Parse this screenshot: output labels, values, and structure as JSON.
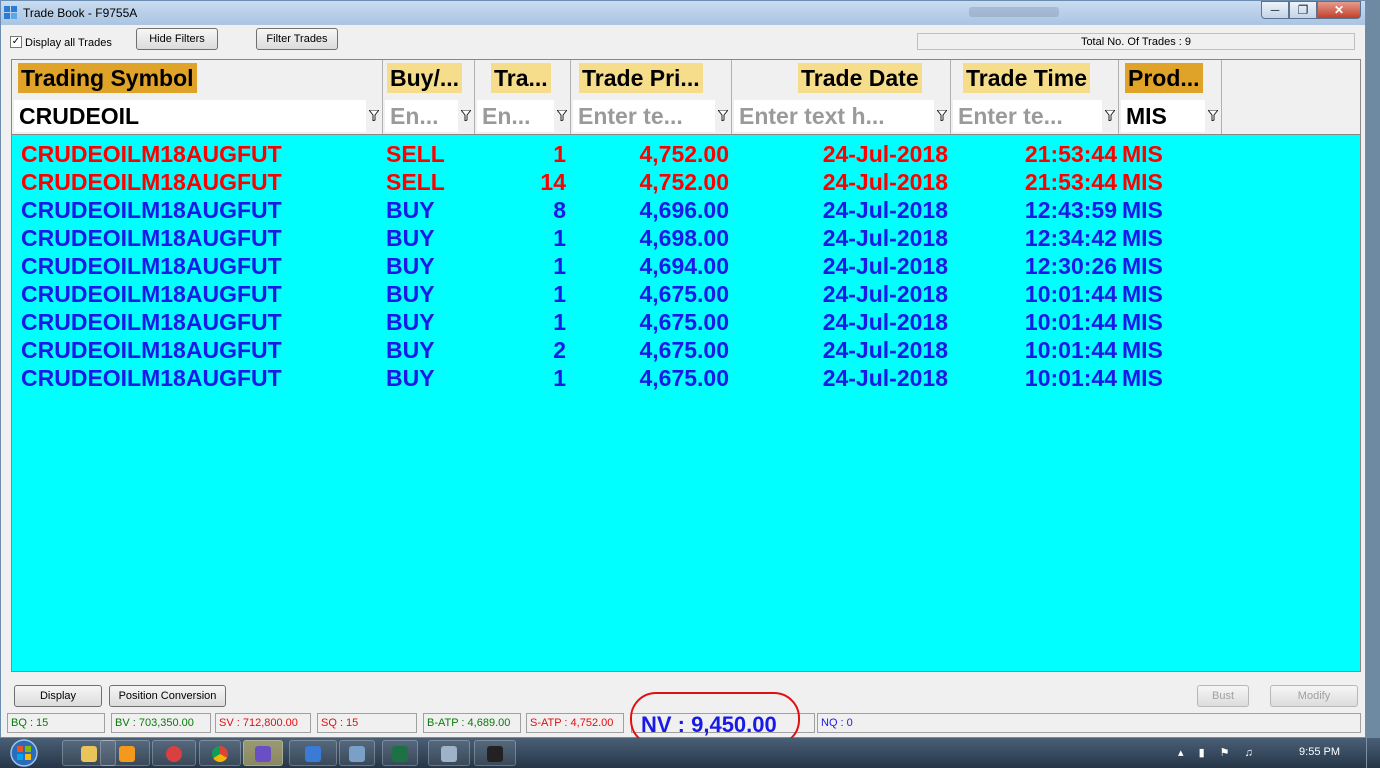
{
  "window": {
    "title": "Trade Book - F9755A"
  },
  "toolbar": {
    "display_all_trades_label": "Display all Trades",
    "display_all_trades_checked": true,
    "hide_filters_label": "Hide Filters",
    "filter_trades_label": "Filter Trades",
    "total_trades_text": "Total No. Of Trades : 9"
  },
  "grid": {
    "background_color": "#00ffff",
    "sell_color": "#ff0000",
    "buy_color": "#1a1ae6",
    "columns": [
      {
        "key": "symbol",
        "header": "Trading Symbol",
        "filter": "CRUDEOIL",
        "filter_is_placeholder": false
      },
      {
        "key": "side",
        "header": "Buy/...",
        "filter": "En...",
        "filter_is_placeholder": true
      },
      {
        "key": "qty",
        "header": "Tra...",
        "filter": "En...",
        "filter_is_placeholder": true
      },
      {
        "key": "price",
        "header": "Trade Pri...",
        "filter": "Enter te...",
        "filter_is_placeholder": true
      },
      {
        "key": "date",
        "header": "Trade Date",
        "filter": "Enter text h...",
        "filter_is_placeholder": true
      },
      {
        "key": "time",
        "header": "Trade Time",
        "filter": "Enter te...",
        "filter_is_placeholder": true
      },
      {
        "key": "product",
        "header": "Prod...",
        "filter": "MIS",
        "filter_is_placeholder": false
      }
    ],
    "rows": [
      {
        "symbol": "CRUDEOILM18AUGFUT",
        "side": "SELL",
        "qty": "1",
        "price": "4,752.00",
        "date": "24-Jul-2018",
        "time": "21:53:44",
        "product": "MIS"
      },
      {
        "symbol": "CRUDEOILM18AUGFUT",
        "side": "SELL",
        "qty": "14",
        "price": "4,752.00",
        "date": "24-Jul-2018",
        "time": "21:53:44",
        "product": "MIS"
      },
      {
        "symbol": "CRUDEOILM18AUGFUT",
        "side": "BUY",
        "qty": "8",
        "price": "4,696.00",
        "date": "24-Jul-2018",
        "time": "12:43:59",
        "product": "MIS"
      },
      {
        "symbol": "CRUDEOILM18AUGFUT",
        "side": "BUY",
        "qty": "1",
        "price": "4,698.00",
        "date": "24-Jul-2018",
        "time": "12:34:42",
        "product": "MIS"
      },
      {
        "symbol": "CRUDEOILM18AUGFUT",
        "side": "BUY",
        "qty": "1",
        "price": "4,694.00",
        "date": "24-Jul-2018",
        "time": "12:30:26",
        "product": "MIS"
      },
      {
        "symbol": "CRUDEOILM18AUGFUT",
        "side": "BUY",
        "qty": "1",
        "price": "4,675.00",
        "date": "24-Jul-2018",
        "time": "10:01:44",
        "product": "MIS"
      },
      {
        "symbol": "CRUDEOILM18AUGFUT",
        "side": "BUY",
        "qty": "1",
        "price": "4,675.00",
        "date": "24-Jul-2018",
        "time": "10:01:44",
        "product": "MIS"
      },
      {
        "symbol": "CRUDEOILM18AUGFUT",
        "side": "BUY",
        "qty": "2",
        "price": "4,675.00",
        "date": "24-Jul-2018",
        "time": "10:01:44",
        "product": "MIS"
      },
      {
        "symbol": "CRUDEOILM18AUGFUT",
        "side": "BUY",
        "qty": "1",
        "price": "4,675.00",
        "date": "24-Jul-2018",
        "time": "10:01:44",
        "product": "MIS"
      }
    ]
  },
  "actions": {
    "display_label": "Display",
    "position_conversion_label": "Position Conversion",
    "bust_label": "Bust",
    "modify_label": "Modify"
  },
  "status": {
    "bq": "BQ : 15",
    "bv": "BV : 703,350.00",
    "sv": "SV : 712,800.00",
    "sq": "SQ : 15",
    "batp": "B-ATP : 4,689.00",
    "satp": "S-ATP : 4,752.00",
    "nv": "NV : 9,450.00",
    "nq": "NQ : 0"
  },
  "taskbar": {
    "clock": "9:55 PM",
    "apps": [
      "file-explorer",
      "media-player",
      "help-icon",
      "chrome",
      "app-triangle",
      "app-blue",
      "app-window",
      "excel",
      "calculator",
      "chart-app"
    ]
  }
}
